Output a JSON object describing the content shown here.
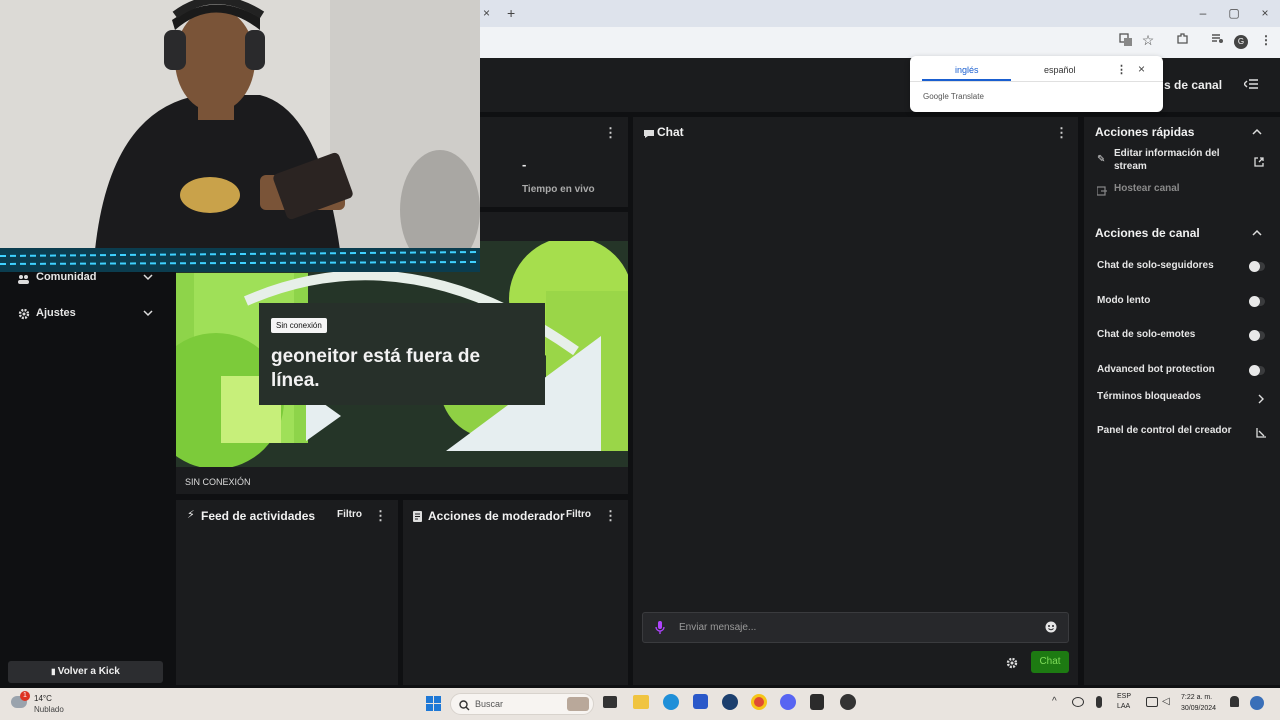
{
  "browser": {
    "tab_close": "×",
    "tab_new": "+",
    "win_min": "–",
    "win_max": "▢",
    "win_close": "×",
    "profile_initial": "G"
  },
  "translate_popup": {
    "lang_from": "inglés",
    "lang_to": "español",
    "brand": "Google Translate"
  },
  "header": {
    "partial_title": "s de canal"
  },
  "stats": {
    "value": "-",
    "label": "Tiempo en vivo"
  },
  "sidebar": {
    "items": [
      {
        "label": "Comunidad"
      },
      {
        "label": "Ajustes"
      }
    ],
    "back_button": "Volver a Kick"
  },
  "player": {
    "badge": "Sin conexión",
    "message": "geoneitor está fuera de línea.",
    "status": "SIN CONEXIÓN"
  },
  "activity_feed": {
    "title": "Feed de actividades",
    "filter": "Filtro"
  },
  "mod_actions": {
    "title": "Acciones de moderador",
    "filter": "Filtro"
  },
  "chat": {
    "title": "Chat",
    "placeholder": "Enviar mensaje...",
    "send_button": "Chat"
  },
  "quick_actions": {
    "title": "Acciones rápidas",
    "items": [
      "Editar información del stream",
      "Hostear canal"
    ]
  },
  "channel_actions": {
    "title": "Acciones de canal",
    "toggles": [
      "Chat de solo-seguidores",
      "Modo lento",
      "Chat de solo-emotes",
      "Advanced bot protection"
    ],
    "links": [
      "Términos bloqueados",
      "Panel de control del creador"
    ]
  },
  "taskbar": {
    "weather_temp": "14°C",
    "weather_desc": "Nublado",
    "weather_badge": "1",
    "search_placeholder": "Buscar",
    "lang_top": "ESP",
    "lang_bottom": "LAA",
    "time": "7:22 a. m.",
    "date": "30/09/2024"
  },
  "colors": {
    "accent_green": "#53fc18",
    "send_green": "#1d7a12",
    "mic_purple": "#b044ff"
  }
}
